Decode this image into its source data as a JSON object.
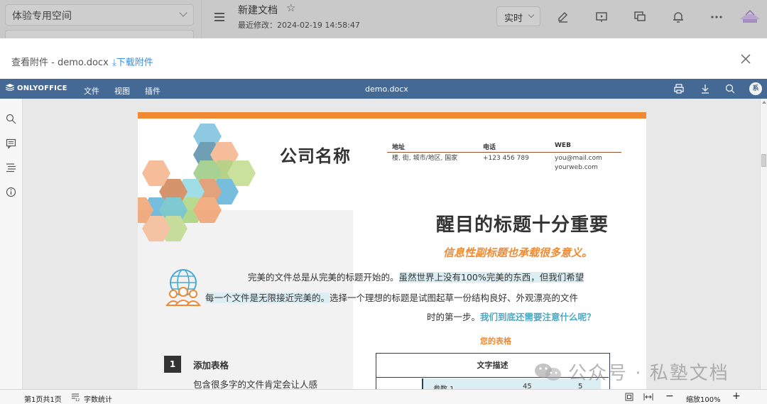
{
  "app": {
    "space_name": "体验专用空间",
    "doc_title": "新建文档",
    "last_modified": "最近修改：2024-02-19 14:58:47",
    "mode_select": "实时"
  },
  "modal": {
    "title": "查看附件 - demo.docx",
    "download_label": "下载附件"
  },
  "editor": {
    "logo": "ONLYOFFICE",
    "menus": [
      "文件",
      "视图",
      "插件"
    ],
    "filename": "demo.docx",
    "user_initial": "系"
  },
  "document": {
    "company_name": "公司名称",
    "contact": {
      "address_label": "地址",
      "address_value": "楼, 街, 城市/地区, 国家",
      "phone_label": "电话",
      "phone_value": "+123 456 789",
      "web_label": "WEB",
      "email_value": "you@mail.com",
      "web_value": "yourweb.com"
    },
    "headline": "醒目的标题十分重要",
    "subheadline": "信息性副标题也承载很多意义。",
    "paragraph": {
      "line1_a": "完美的文件总是从完美的标题开始的。",
      "line1_b": "虽然世界上没有100%完美的东西，但我们希望",
      "line2_a": "每一个文件是无限接近完美的。",
      "line2_b": "选择一个理想的标题是试图起草一份结构良好、外观漂亮的文件",
      "line3_a": "时的第一步。",
      "line3_b": "我们到底还需要注意什么呢？"
    },
    "table_title": "您的表格",
    "section": {
      "number": "1",
      "title": "添加表格",
      "text": "包含很多字的文件肯定会让人感"
    },
    "table": {
      "header": "文字描述",
      "row1": [
        "参数 1",
        "45",
        "5"
      ]
    }
  },
  "watermark": "公众号 · 私塾文档",
  "status": {
    "page_info": "第1页共1页",
    "word_count": "字数统计",
    "zoom": "缩放100%"
  },
  "colors": {
    "editor_bar": "#446995",
    "accent_orange": "#f08a32",
    "link_blue": "#3a8ee6",
    "highlight": "#dbeef3"
  }
}
